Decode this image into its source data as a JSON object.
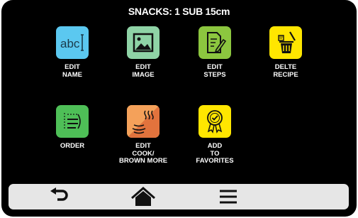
{
  "header": {
    "title": "SNACKS: 1 SUB 15cm"
  },
  "tiles": {
    "edit_name": {
      "icon_text": "abc",
      "line1": "EDIT",
      "line2": "NAME",
      "icon": "text-cursor-icon",
      "color": "#5bc8f0"
    },
    "edit_image": {
      "line1": "EDIT",
      "line2": "IMAGE",
      "icon": "picture-icon",
      "color": "#8fd3a6"
    },
    "edit_steps": {
      "line1": "EDIT",
      "line2": "STEPS",
      "icon": "document-pencil-icon",
      "color": "#8cc63f"
    },
    "delete_recipe": {
      "line1": "DELTE",
      "line2": "RECIPE",
      "icon": "trash-icon",
      "color": "#ffe600"
    },
    "order": {
      "line1": "ORDER",
      "icon": "list-icon",
      "color": "#4ebf57"
    },
    "edit_cook": {
      "line1": "EDIT",
      "line2": "COOK/",
      "line3": "BROWN MORE",
      "icon": "heat-waves-icon",
      "color_a": "#f4a15a",
      "color_b": "#d6c25a"
    },
    "favorites": {
      "line1": "ADD",
      "line2": "TO",
      "line3": "FAVORITES",
      "icon": "award-ribbon-icon",
      "color": "#ffe600"
    }
  },
  "nav": {
    "back": {
      "icon": "back-arrow-icon"
    },
    "home": {
      "icon": "home-icon"
    },
    "menu": {
      "icon": "hamburger-menu-icon"
    }
  }
}
